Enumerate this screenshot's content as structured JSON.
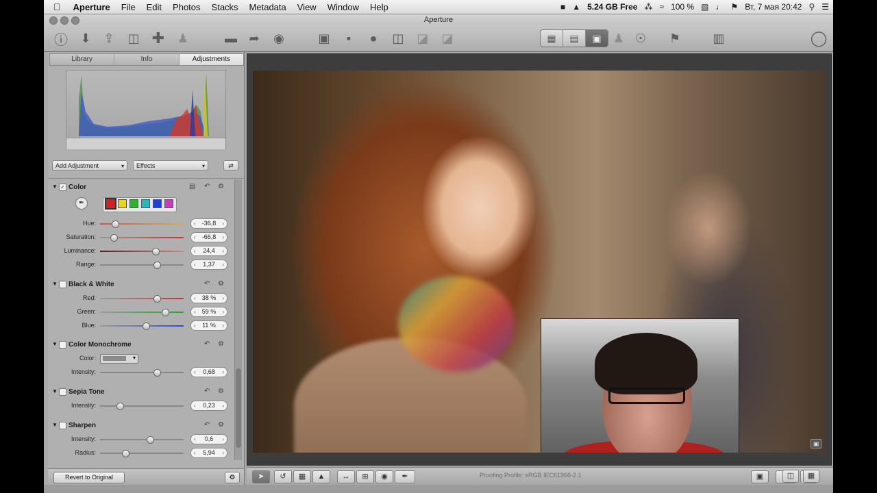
{
  "menubar": {
    "app_name": "Aperture",
    "items": [
      "File",
      "Edit",
      "Photos",
      "Stacks",
      "Metadata",
      "View",
      "Window",
      "Help"
    ],
    "disk_free": "5.24 GB Free",
    "battery": "100 %",
    "datetime": "Вт, 7 мая  20:42"
  },
  "window": {
    "title": "Aperture"
  },
  "tabs": [
    {
      "label": "Library"
    },
    {
      "label": "Info"
    },
    {
      "label": "Adjustments",
      "active": true
    }
  ],
  "controls": {
    "add_adjustment": "Add Adjustment",
    "effects": "Effects"
  },
  "sections": {
    "color": {
      "title": "Color",
      "checked": true,
      "swatches": [
        "#d42020",
        "#e8d418",
        "#30b030",
        "#2ab8c0",
        "#2040d0",
        "#c83ac8"
      ],
      "rows": [
        {
          "label": "Hue:",
          "value": "-36,8",
          "pos": 0.18
        },
        {
          "label": "Saturation:",
          "value": "-66,8",
          "pos": 0.16
        },
        {
          "label": "Luminance:",
          "value": "24,4",
          "pos": 0.66
        },
        {
          "label": "Range:",
          "value": "1,37",
          "pos": 0.68
        }
      ]
    },
    "bw": {
      "title": "Black & White",
      "rows": [
        {
          "label": "Red:",
          "value": "38 %",
          "pos": 0.68
        },
        {
          "label": "Green:",
          "value": "59 %",
          "pos": 0.78
        },
        {
          "label": "Blue:",
          "value": "11 %",
          "pos": 0.55
        }
      ]
    },
    "mono": {
      "title": "Color Monochrome",
      "color_label": "Color:",
      "rows": [
        {
          "label": "Intensity:",
          "value": "0,68",
          "pos": 0.68
        }
      ]
    },
    "sepia": {
      "title": "Sepia Tone",
      "rows": [
        {
          "label": "Intensity:",
          "value": "0,23",
          "pos": 0.24
        }
      ]
    },
    "sharpen": {
      "title": "Sharpen",
      "rows": [
        {
          "label": "Intensity:",
          "value": "0,6",
          "pos": 0.6
        },
        {
          "label": "Radius:",
          "value": "5,94",
          "pos": 0.3
        }
      ]
    }
  },
  "footer": {
    "revert": "Revert to Original",
    "proofing": "Proofing Profile: sRGB IEC61966-2.1"
  },
  "colors": {
    "panel_bg": "#b0b0b0",
    "toolbar_bg": "#b8b8b8",
    "viewer_bg": "#3d3d3d"
  }
}
